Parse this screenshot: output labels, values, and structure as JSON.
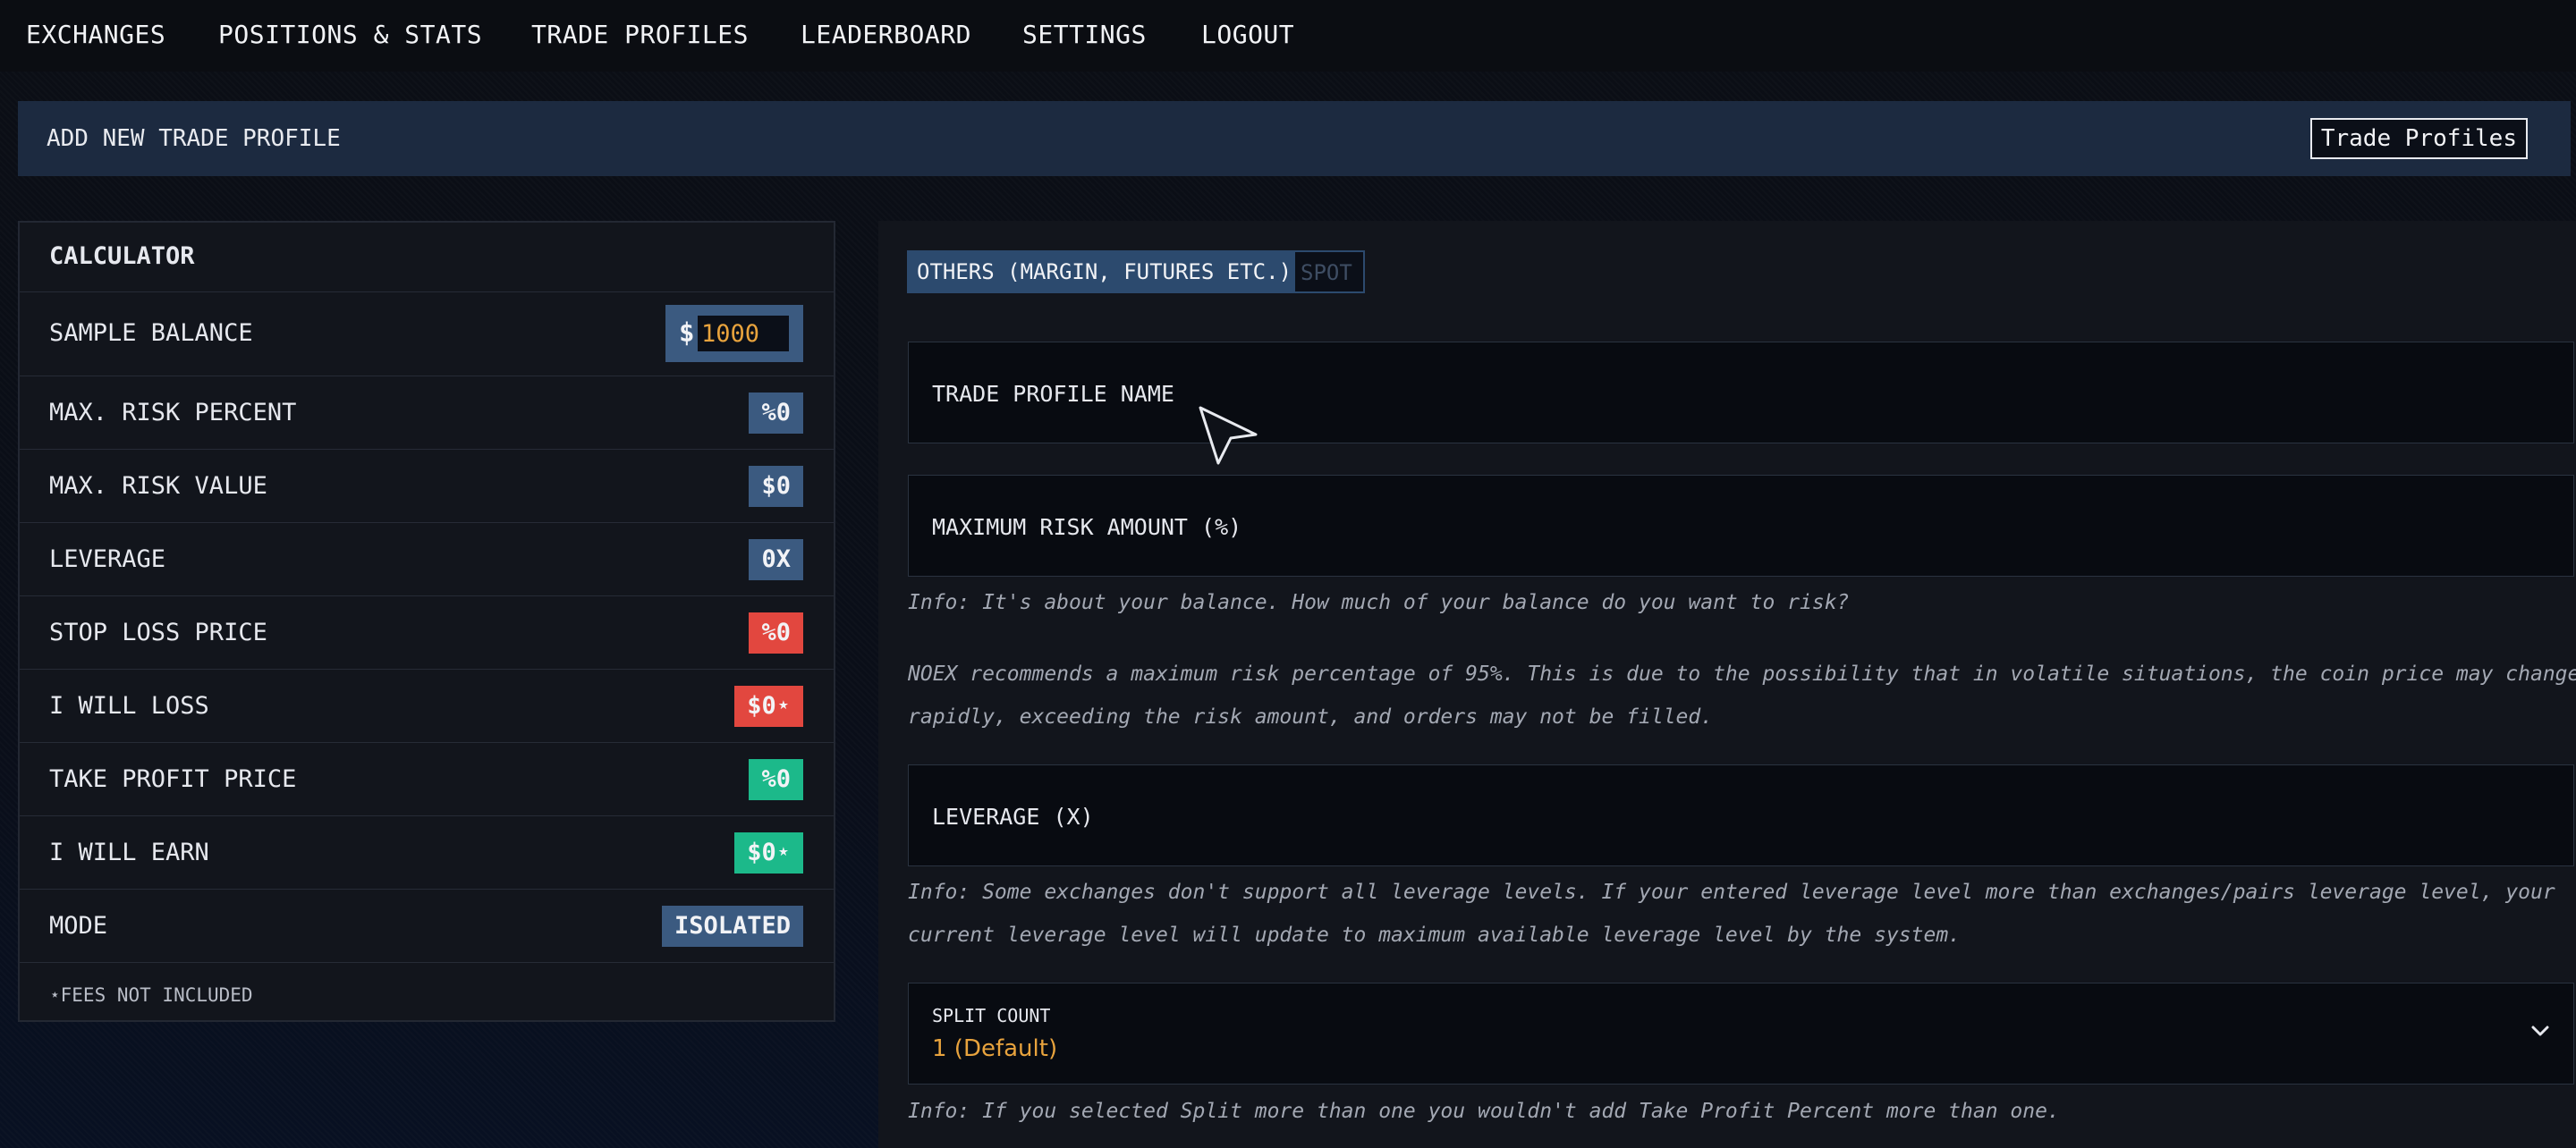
{
  "nav": {
    "items": [
      {
        "label": "EXCHANGES"
      },
      {
        "label": "POSITIONS & STATS"
      },
      {
        "label": "TRADE PROFILES"
      },
      {
        "label": "LEADERBOARD"
      },
      {
        "label": "SETTINGS"
      },
      {
        "label": "LOGOUT"
      }
    ]
  },
  "header": {
    "title": "ADD NEW TRADE PROFILE",
    "button_label": "Trade Profiles"
  },
  "calculator": {
    "title": "CALCULATOR",
    "sample_balance": {
      "label": "SAMPLE BALANCE",
      "currency": "$",
      "value": "1000"
    },
    "rows": [
      {
        "label": "MAX. RISK PERCENT",
        "value": "%0"
      },
      {
        "label": "MAX. RISK VALUE",
        "value": "$0"
      },
      {
        "label": "LEVERAGE",
        "value": "0X"
      },
      {
        "label": "STOP LOSS PRICE",
        "value": "%0"
      },
      {
        "label": "I WILL LOSS",
        "value": "$0⋆"
      },
      {
        "label": "TAKE PROFIT PRICE",
        "value": "%0"
      },
      {
        "label": "I WILL EARN",
        "value": "$0⋆"
      },
      {
        "label": "MODE",
        "value": "ISOLATED"
      }
    ],
    "fees_note": "⋆FEES NOT INCLUDED"
  },
  "form": {
    "tabs": [
      {
        "label": "OTHERS (MARGIN, FUTURES ETC.)",
        "active": true
      },
      {
        "label": "SPOT",
        "active": false
      }
    ],
    "fields": {
      "trade_profile_name": "TRADE PROFILE NAME",
      "maximum_risk_amount": "MAXIMUM RISK AMOUNT (%)",
      "leverage": "LEVERAGE (X)"
    },
    "info": {
      "risk_1": "Info: It's about your balance. How much of your balance do you want to risk?",
      "risk_2": "NOEX recommends a maximum risk percentage of 95%. This is due to the possibility that in volatile situations, the coin price may change",
      "risk_3": "rapidly, exceeding the risk amount, and orders may not be filled.",
      "leverage_1": "Info: Some exchanges don't support all leverage levels. If your entered leverage level more than exchanges/pairs leverage level, your",
      "leverage_2": "current leverage level will update to maximum available leverage level by the system.",
      "split": "Info: If you selected Split more than one you wouldn't add Take Profit Percent more than one."
    },
    "split_count": {
      "label": "SPLIT COUNT",
      "value": "1 (Default)"
    }
  },
  "colors": {
    "accent_blue": "#3b5a80",
    "loss_red": "#e2473f",
    "profit_green": "#1cb98a",
    "value_orange": "#e8a33d"
  }
}
